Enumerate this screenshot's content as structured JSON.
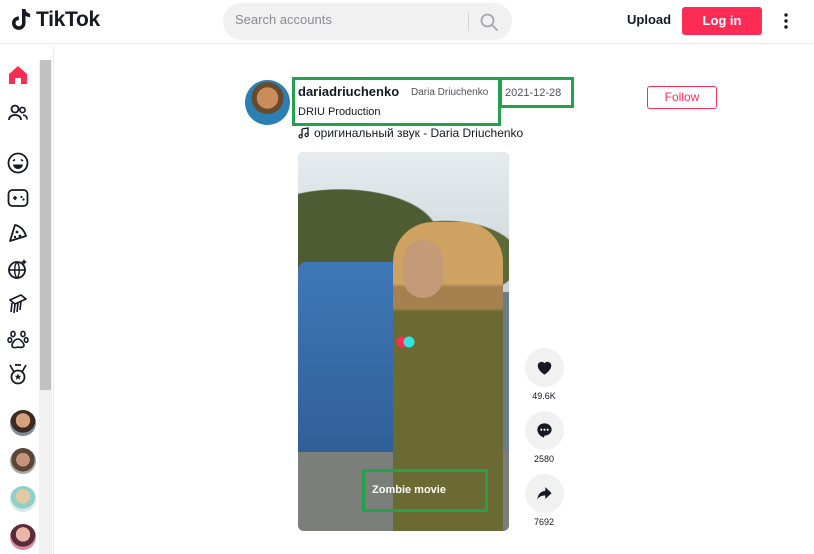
{
  "header": {
    "brand": "TikTok",
    "search_placeholder": "Search accounts",
    "upload_label": "Upload",
    "login_label": "Log in"
  },
  "sidebar": {
    "icons": [
      "home-icon",
      "following-icon",
      "comedy-icon",
      "gaming-icon",
      "food-icon",
      "dance-icon",
      "beauty-icon",
      "animals-icon",
      "sports-icon"
    ]
  },
  "post": {
    "username": "dariadriuchenko",
    "nickname": "Daria Driuchenko",
    "date": "2021-12-28",
    "description": "DRIU Production",
    "music": "оригинальный звук - Daria Driuchenko",
    "follow_label": "Follow",
    "caption": "Zombie movie",
    "likes": "49.6K",
    "comments": "2580",
    "shares": "7692"
  },
  "colors": {
    "accent": "#fe2c55",
    "highlight": "#22a24c"
  }
}
